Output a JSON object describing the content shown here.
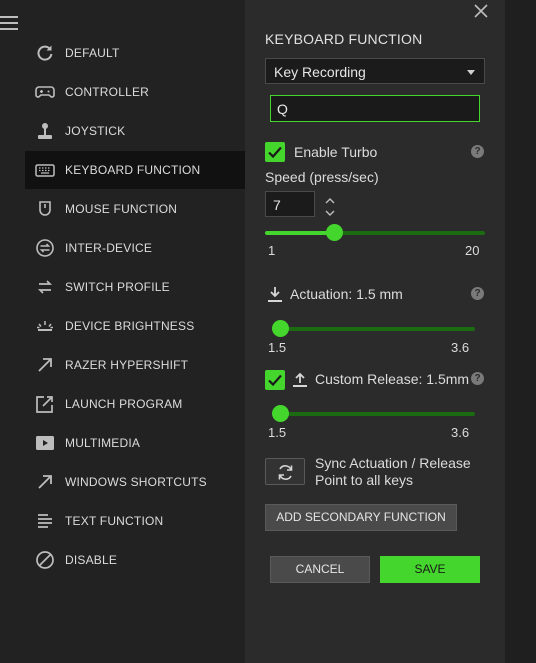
{
  "sidebar": {
    "items": [
      {
        "label": "DEFAULT",
        "icon": "reset-icon"
      },
      {
        "label": "CONTROLLER",
        "icon": "gamepad-icon"
      },
      {
        "label": "JOYSTICK",
        "icon": "joystick-icon"
      },
      {
        "label": "KEYBOARD FUNCTION",
        "icon": "keyboard-icon",
        "active": true
      },
      {
        "label": "MOUSE FUNCTION",
        "icon": "mouse-icon"
      },
      {
        "label": "INTER-DEVICE",
        "icon": "inter-device-icon"
      },
      {
        "label": "SWITCH PROFILE",
        "icon": "switch-profile-icon"
      },
      {
        "label": "DEVICE BRIGHTNESS",
        "icon": "brightness-icon"
      },
      {
        "label": "RAZER HYPERSHIFT",
        "icon": "hypershift-arrow-icon"
      },
      {
        "label": "LAUNCH PROGRAM",
        "icon": "launch-program-icon"
      },
      {
        "label": "MULTIMEDIA",
        "icon": "play-icon"
      },
      {
        "label": "WINDOWS SHORTCUTS",
        "icon": "shortcut-arrow-icon"
      },
      {
        "label": "TEXT FUNCTION",
        "icon": "text-lines-icon"
      },
      {
        "label": "DISABLE",
        "icon": "disable-icon"
      }
    ]
  },
  "panel": {
    "title": "KEYBOARD FUNCTION",
    "mode_select": "Key Recording",
    "key_value": "Q",
    "turbo": {
      "enabled": true,
      "label": "Enable Turbo",
      "help": "?",
      "speed_label": "Speed (press/sec)",
      "speed_value": "7",
      "slider": {
        "min": 1,
        "max": 20,
        "value": 7,
        "min_label": "1",
        "max_label": "20"
      }
    },
    "actuation": {
      "label": "Actuation: 1.5 mm",
      "help": "?",
      "slider": {
        "min": 1.5,
        "max": 3.6,
        "value": 1.5,
        "min_label": "1.5",
        "max_label": "3.6"
      }
    },
    "custom_release": {
      "enabled": true,
      "label": "Custom Release: 1.5mm",
      "help": "?",
      "slider": {
        "min": 1.5,
        "max": 3.6,
        "value": 1.5,
        "min_label": "1.5",
        "max_label": "3.6"
      }
    },
    "sync_label": "Sync Actuation / Release Point to all keys",
    "add_secondary_label": "ADD SECONDARY FUNCTION",
    "cancel_label": "CANCEL",
    "save_label": "SAVE"
  },
  "colors": {
    "accent": "#44d62c",
    "track": "#1b6c10",
    "panel_bg": "#2b2b2b",
    "sidebar_bg": "#222222"
  }
}
